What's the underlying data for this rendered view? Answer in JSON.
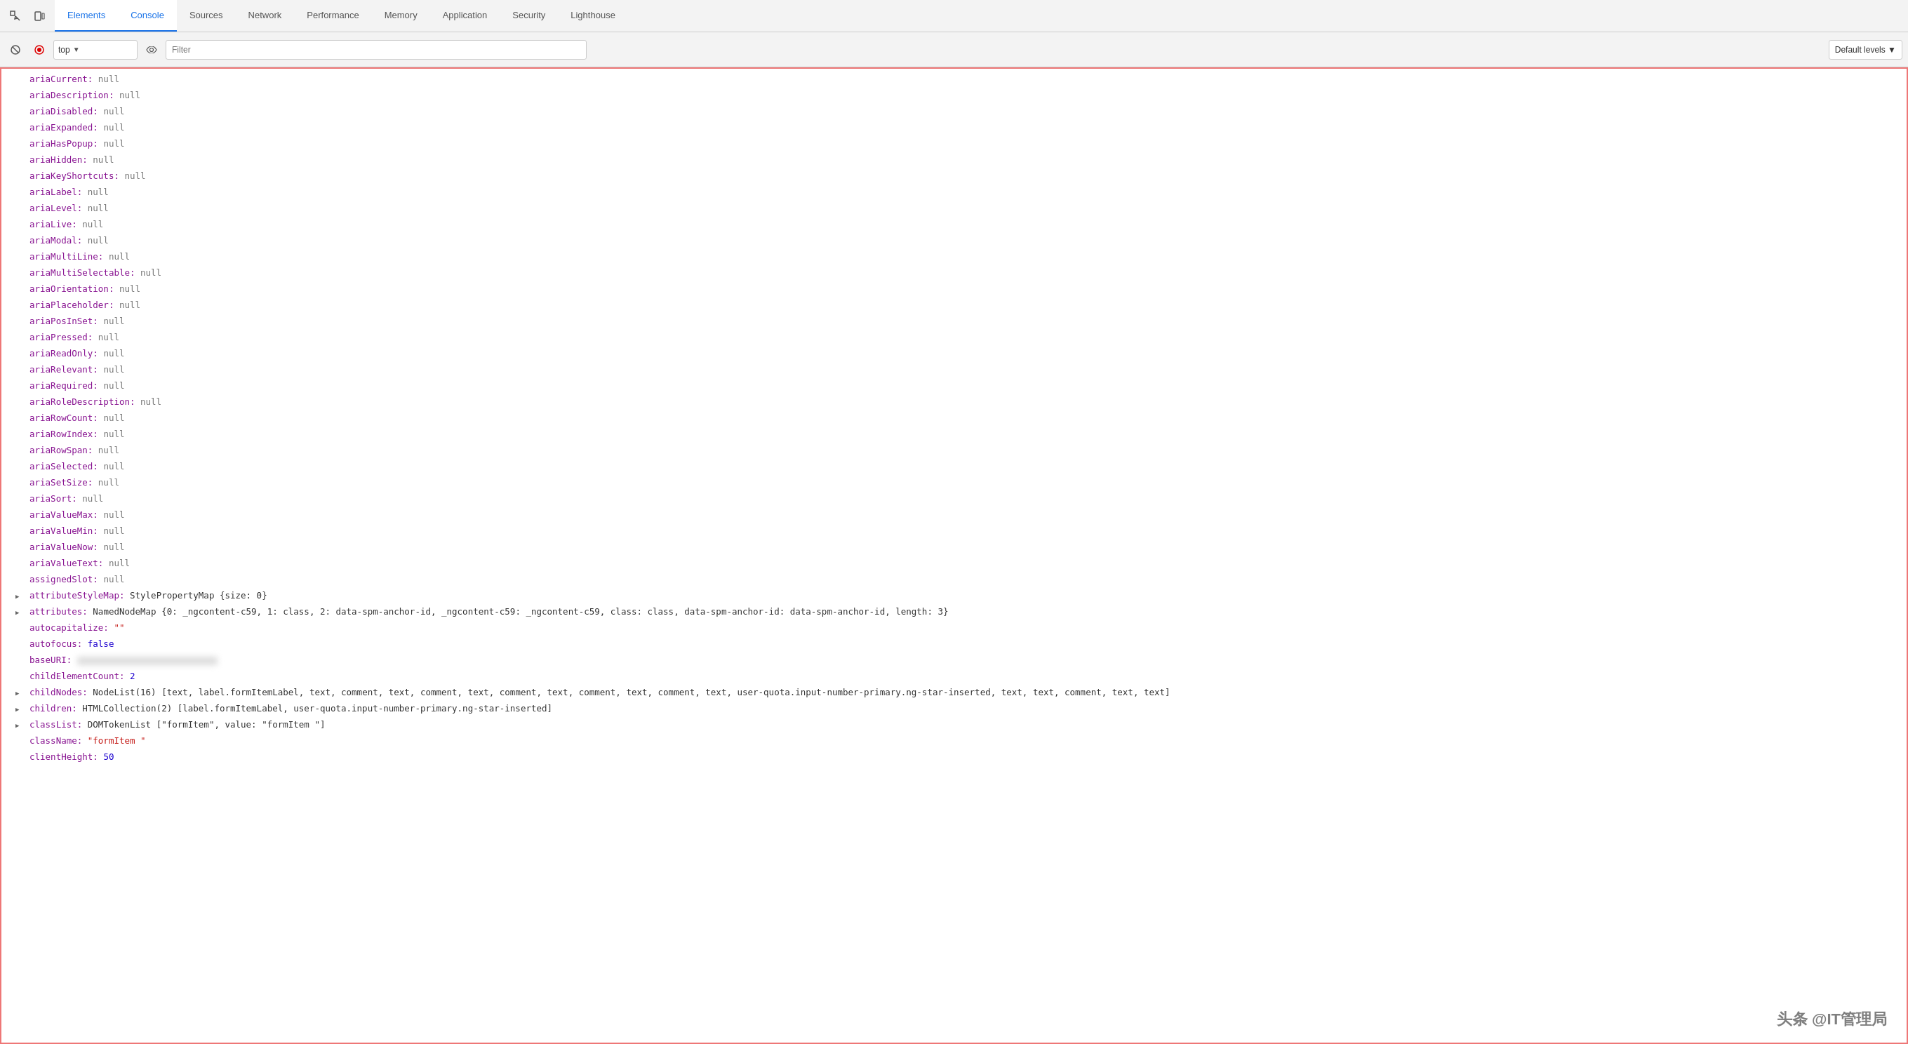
{
  "tabs": [
    {
      "label": "Elements",
      "active": false
    },
    {
      "label": "Console",
      "active": true
    },
    {
      "label": "Sources",
      "active": false
    },
    {
      "label": "Network",
      "active": false
    },
    {
      "label": "Performance",
      "active": false
    },
    {
      "label": "Memory",
      "active": false
    },
    {
      "label": "Application",
      "active": false
    },
    {
      "label": "Security",
      "active": false
    },
    {
      "label": "Lighthouse",
      "active": false
    }
  ],
  "toolbar": {
    "context_value": "top",
    "filter_placeholder": "Filter",
    "level_label": "Default levels ▼"
  },
  "console_lines": [
    {
      "type": "prop",
      "name": "ariaCurrent:",
      "value": "null",
      "valueType": "null",
      "expandable": false
    },
    {
      "type": "prop",
      "name": "ariaDescription:",
      "value": "null",
      "valueType": "null",
      "expandable": false
    },
    {
      "type": "prop",
      "name": "ariaDisabled:",
      "value": "null",
      "valueType": "null",
      "expandable": false
    },
    {
      "type": "prop",
      "name": "ariaExpanded:",
      "value": "null",
      "valueType": "null",
      "expandable": false
    },
    {
      "type": "prop",
      "name": "ariaHasPopup:",
      "value": "null",
      "valueType": "null",
      "expandable": false
    },
    {
      "type": "prop",
      "name": "ariaHidden:",
      "value": "null",
      "valueType": "null",
      "expandable": false
    },
    {
      "type": "prop",
      "name": "ariaKeyShortcuts:",
      "value": "null",
      "valueType": "null",
      "expandable": false
    },
    {
      "type": "prop",
      "name": "ariaLabel:",
      "value": "null",
      "valueType": "null",
      "expandable": false
    },
    {
      "type": "prop",
      "name": "ariaLevel:",
      "value": "null",
      "valueType": "null",
      "expandable": false
    },
    {
      "type": "prop",
      "name": "ariaLive:",
      "value": "null",
      "valueType": "null",
      "expandable": false
    },
    {
      "type": "prop",
      "name": "ariaModal:",
      "value": "null",
      "valueType": "null",
      "expandable": false
    },
    {
      "type": "prop",
      "name": "ariaMultiLine:",
      "value": "null",
      "valueType": "null",
      "expandable": false
    },
    {
      "type": "prop",
      "name": "ariaMultiSelectable:",
      "value": "null",
      "valueType": "null",
      "expandable": false
    },
    {
      "type": "prop",
      "name": "ariaOrientation:",
      "value": "null",
      "valueType": "null",
      "expandable": false
    },
    {
      "type": "prop",
      "name": "ariaPlaceholder:",
      "value": "null",
      "valueType": "null",
      "expandable": false
    },
    {
      "type": "prop",
      "name": "ariaPosInSet:",
      "value": "null",
      "valueType": "null",
      "expandable": false
    },
    {
      "type": "prop",
      "name": "ariaPressed:",
      "value": "null",
      "valueType": "null",
      "expandable": false
    },
    {
      "type": "prop",
      "name": "ariaReadOnly:",
      "value": "null",
      "valueType": "null",
      "expandable": false
    },
    {
      "type": "prop",
      "name": "ariaRelevant:",
      "value": "null",
      "valueType": "null",
      "expandable": false
    },
    {
      "type": "prop",
      "name": "ariaRequired:",
      "value": "null",
      "valueType": "null",
      "expandable": false
    },
    {
      "type": "prop",
      "name": "ariaRoleDescription:",
      "value": "null",
      "valueType": "null",
      "expandable": false
    },
    {
      "type": "prop",
      "name": "ariaRowCount:",
      "value": "null",
      "valueType": "null",
      "expandable": false
    },
    {
      "type": "prop",
      "name": "ariaRowIndex:",
      "value": "null",
      "valueType": "null",
      "expandable": false
    },
    {
      "type": "prop",
      "name": "ariaRowSpan:",
      "value": "null",
      "valueType": "null",
      "expandable": false
    },
    {
      "type": "prop",
      "name": "ariaSelected:",
      "value": "null",
      "valueType": "null",
      "expandable": false
    },
    {
      "type": "prop",
      "name": "ariaSetSize:",
      "value": "null",
      "valueType": "null",
      "expandable": false
    },
    {
      "type": "prop",
      "name": "ariaSort:",
      "value": "null",
      "valueType": "null",
      "expandable": false
    },
    {
      "type": "prop",
      "name": "ariaValueMax:",
      "value": "null",
      "valueType": "null",
      "expandable": false
    },
    {
      "type": "prop",
      "name": "ariaValueMin:",
      "value": "null",
      "valueType": "null",
      "expandable": false
    },
    {
      "type": "prop",
      "name": "ariaValueNow:",
      "value": "null",
      "valueType": "null",
      "expandable": false
    },
    {
      "type": "prop",
      "name": "ariaValueText:",
      "value": "null",
      "valueType": "null",
      "expandable": false
    },
    {
      "type": "prop",
      "name": "assignedSlot:",
      "value": "null",
      "valueType": "null",
      "expandable": false
    },
    {
      "type": "prop",
      "name": "attributeStyleMap:",
      "value": "StylePropertyMap {size: 0}",
      "valueType": "complex",
      "expandable": true
    },
    {
      "type": "prop",
      "name": "attributes:",
      "value": "NamedNodeMap {0: _ngcontent-c59, 1: class, 2: data-spm-anchor-id, _ngcontent-c59: _ngcontent-c59, class: class, data-spm-anchor-id: data-spm-anchor-id, length: 3}",
      "valueType": "complex",
      "expandable": true
    },
    {
      "type": "prop",
      "name": "autocapitalize:",
      "value": "\"\"",
      "valueType": "string",
      "expandable": false
    },
    {
      "type": "prop",
      "name": "autofocus:",
      "value": "false",
      "valueType": "bool",
      "expandable": false
    },
    {
      "type": "prop",
      "name": "baseURI:",
      "value": "BLURRED",
      "valueType": "blurred",
      "expandable": false
    },
    {
      "type": "prop",
      "name": "childElementCount:",
      "value": "2",
      "valueType": "number",
      "expandable": false
    },
    {
      "type": "prop",
      "name": "childNodes:",
      "value": "NodeList(16) [text, label.formItemLabel, text, comment, text, comment, text, comment, text, comment, text, comment, text, user-quota.input-number-primary.ng-star-inserted, text, text, comment, text, text]",
      "valueType": "complex",
      "expandable": true
    },
    {
      "type": "prop",
      "name": "children:",
      "value": "HTMLCollection(2) [label.formItemLabel, user-quota.input-number-primary.ng-star-inserted]",
      "valueType": "complex",
      "expandable": true
    },
    {
      "type": "prop",
      "name": "classList:",
      "value": "DOMTokenList [\"formItem\", value: \"formItem \"]",
      "valueType": "complex",
      "expandable": true
    },
    {
      "type": "prop",
      "name": "className:",
      "value": "\"formItem \"",
      "valueType": "string",
      "expandable": false
    },
    {
      "type": "prop",
      "name": "clientHeight:",
      "value": "50",
      "valueType": "number",
      "expandable": false
    }
  ],
  "watermark": "头条 @IT管理局"
}
